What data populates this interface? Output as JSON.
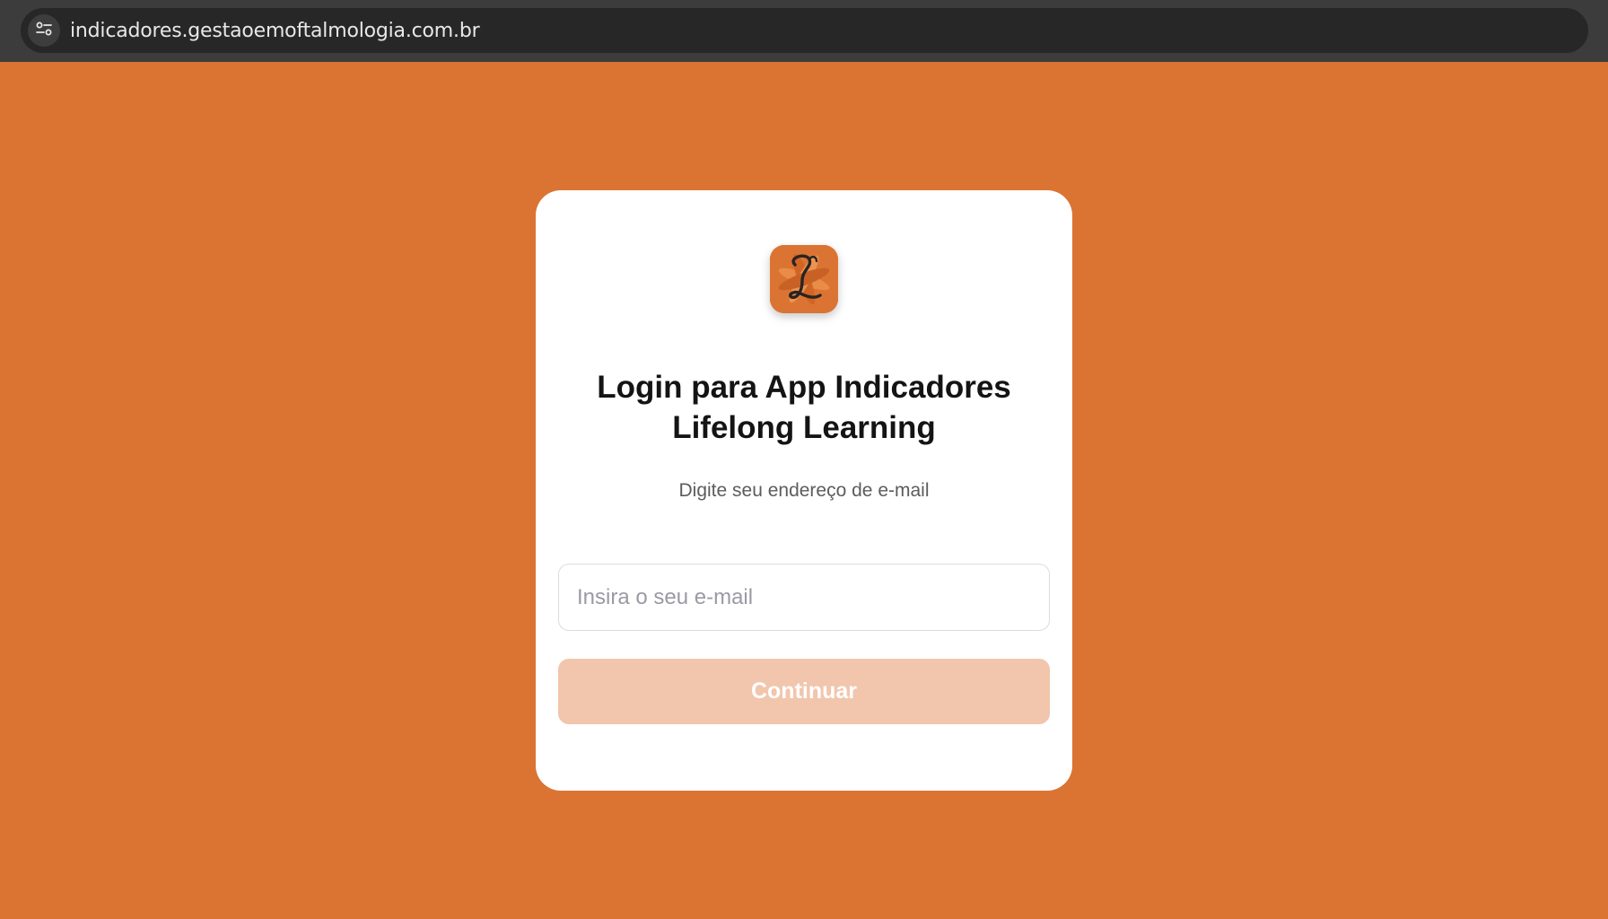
{
  "browser": {
    "url": "indicadores.gestaoemoftalmologia.com.br",
    "site_info_icon": "tune-icon"
  },
  "login": {
    "logo_icon": "lifelong-learning-logo",
    "title_line1": "Login para App Indicadores",
    "title_line2": "Lifelong Learning",
    "subtitle": "Digite seu endereço de e-mail",
    "email_placeholder": "Insira o seu e-mail",
    "email_value": "",
    "continue_label": "Continuar"
  },
  "colors": {
    "background": "#DB7432",
    "card": "#FFFFFF",
    "button_disabled": "#F1C6AD",
    "title_text": "#141414",
    "subtitle_text": "#5C5C5C"
  }
}
